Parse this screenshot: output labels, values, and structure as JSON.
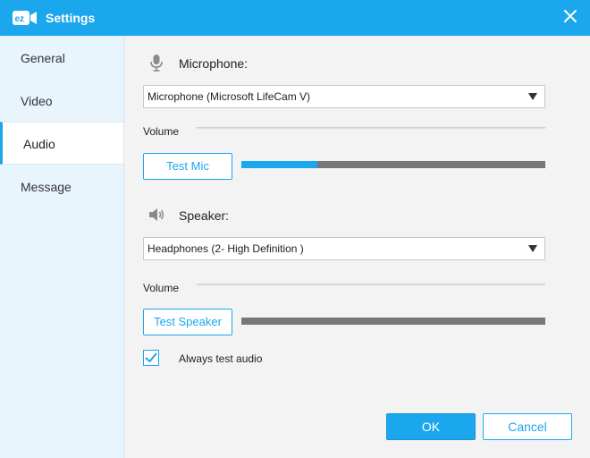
{
  "window": {
    "title": "Settings",
    "logo_text": "ez"
  },
  "sidebar": {
    "items": [
      {
        "label": "General",
        "active": false
      },
      {
        "label": "Video",
        "active": false
      },
      {
        "label": "Audio",
        "active": true
      },
      {
        "label": "Message",
        "active": false
      }
    ]
  },
  "microphone": {
    "title": "Microphone:",
    "device": "Microphone (Microsoft LifeCam V)",
    "volume_label": "Volume",
    "test_label": "Test Mic",
    "level": 0.25,
    "icon": "microphone-icon"
  },
  "speaker": {
    "title": "Speaker:",
    "device": "Headphones (2- High Definition )",
    "volume_label": "Volume",
    "test_label": "Test Speaker",
    "level": 0.0,
    "icon": "speaker-icon"
  },
  "options": {
    "always_test_audio_label": "Always test audio",
    "always_test_audio_checked": true
  },
  "footer": {
    "ok_label": "OK",
    "cancel_label": "Cancel"
  },
  "colors": {
    "accent": "#1ba7ee",
    "level_track": "#777777"
  }
}
